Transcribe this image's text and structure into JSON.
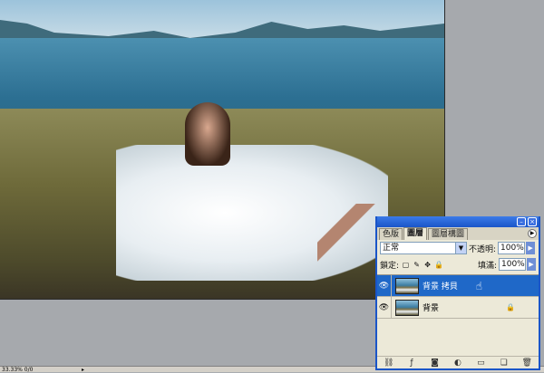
{
  "layers_panel": {
    "tabs": [
      "色版",
      "圖層",
      "圖層構圖"
    ],
    "blend_mode": "正常",
    "opacity_label": "不透明:",
    "opacity_value": "100%",
    "lock_label": "鎖定:",
    "fill_label": "填滿:",
    "fill_value": "100%",
    "layers": [
      {
        "name": "背景 拷貝",
        "selected": true
      },
      {
        "name": "背景",
        "locked": true
      }
    ],
    "accent_color": "#1f68c8"
  },
  "status_bar": {
    "text": "33.33% 0/0"
  },
  "icons": {
    "eye": "eye-icon",
    "lock": "lock-icon",
    "menu": "panel-menu-icon",
    "minimize": "minimize-icon",
    "close": "close-icon",
    "cursor": "hand-cursor-icon"
  }
}
